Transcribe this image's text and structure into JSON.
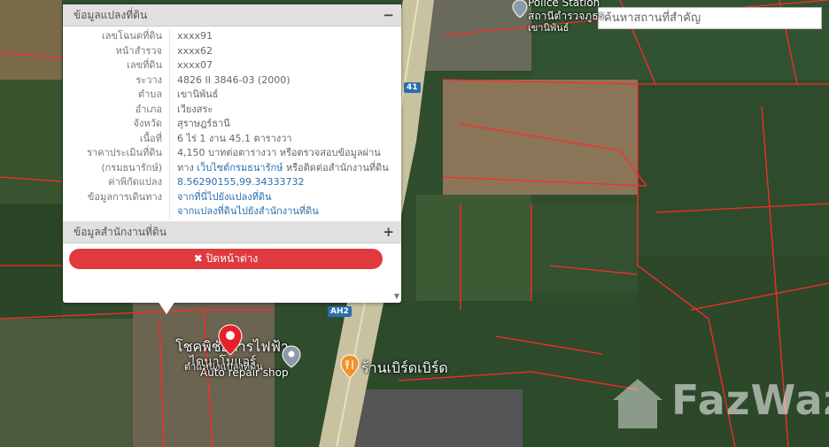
{
  "search": {
    "placeholder": "ค้นหาสถานที่สำคัญ"
  },
  "panel": {
    "header_title": "ข้อมูลแปลงที่ดิน",
    "header_toggle": "−",
    "rows": [
      {
        "label": "เลขโฉนดที่ดิน",
        "value": "xxxx91"
      },
      {
        "label": "หน้าสำรวจ",
        "value": "xxxx62"
      },
      {
        "label": "เลขที่ดิน",
        "value": "xxxx07"
      },
      {
        "label": "ระวาง",
        "value": "4826 II 3846-03 (2000)"
      },
      {
        "label": "ตำบล",
        "value": "เขานิพันธ์"
      },
      {
        "label": "อำเภอ",
        "value": "เวียงสระ"
      },
      {
        "label": "จังหวัด",
        "value": "สุราษฎร์ธานี"
      },
      {
        "label": "เนื้อที่",
        "value": "6 ไร่ 1 งาน 45.1 ตารางวา"
      }
    ],
    "price": {
      "label1": "ราคาประเมินที่ดิน",
      "label2": "(กรมธนารักษ์)",
      "line1": "4,150 บาทต่อตารางวา หรือตรวจสอบข้อมูลผ่าน",
      "line2_pre": "ทาง ",
      "line2_link": "เว็บไซต์กรมธนารักษ์",
      "line2_post": " หรือติดต่อสำนักงานที่ดิน"
    },
    "coords": {
      "label": "ค่าพิกัดแปลง",
      "value": "8.56290155,99.34333732"
    },
    "travel": {
      "label": "ข้อมูลการเดินทาง",
      "link1": "จากที่นี่ไปยังแปลงที่ดิน",
      "link2": "จากแปลงที่ดินไปยังสำนักงานที่ดิน"
    },
    "office": {
      "title": "ข้อมูลสำนักงานที่ดิน",
      "toggle": "+"
    },
    "close_button": "✖ ปิดหน้าต่าง"
  },
  "map_labels": {
    "police_top": "Police Station",
    "police_th1": "สถานีตำรวจภูธร",
    "police_th2": "เขานิพันธ์",
    "road_41": "41",
    "road_ah2": "AH2",
    "shop_th1": "โชคพิชัยการไฟฟ้า",
    "shop_th2": "ไดนาโมแอร์",
    "land_pos": "ตำแหน่งแปลงที่ดิน",
    "auto_repair": "Auto repair shop",
    "restaurant": "ร้านเบิร์ดเบิร์ด",
    "watermark": "FazWaz"
  },
  "colors": {
    "close_button": "#e03a3e",
    "link": "#2a6fb0",
    "parcel_line": "#ff2a2a",
    "marker": "#e8202a"
  }
}
